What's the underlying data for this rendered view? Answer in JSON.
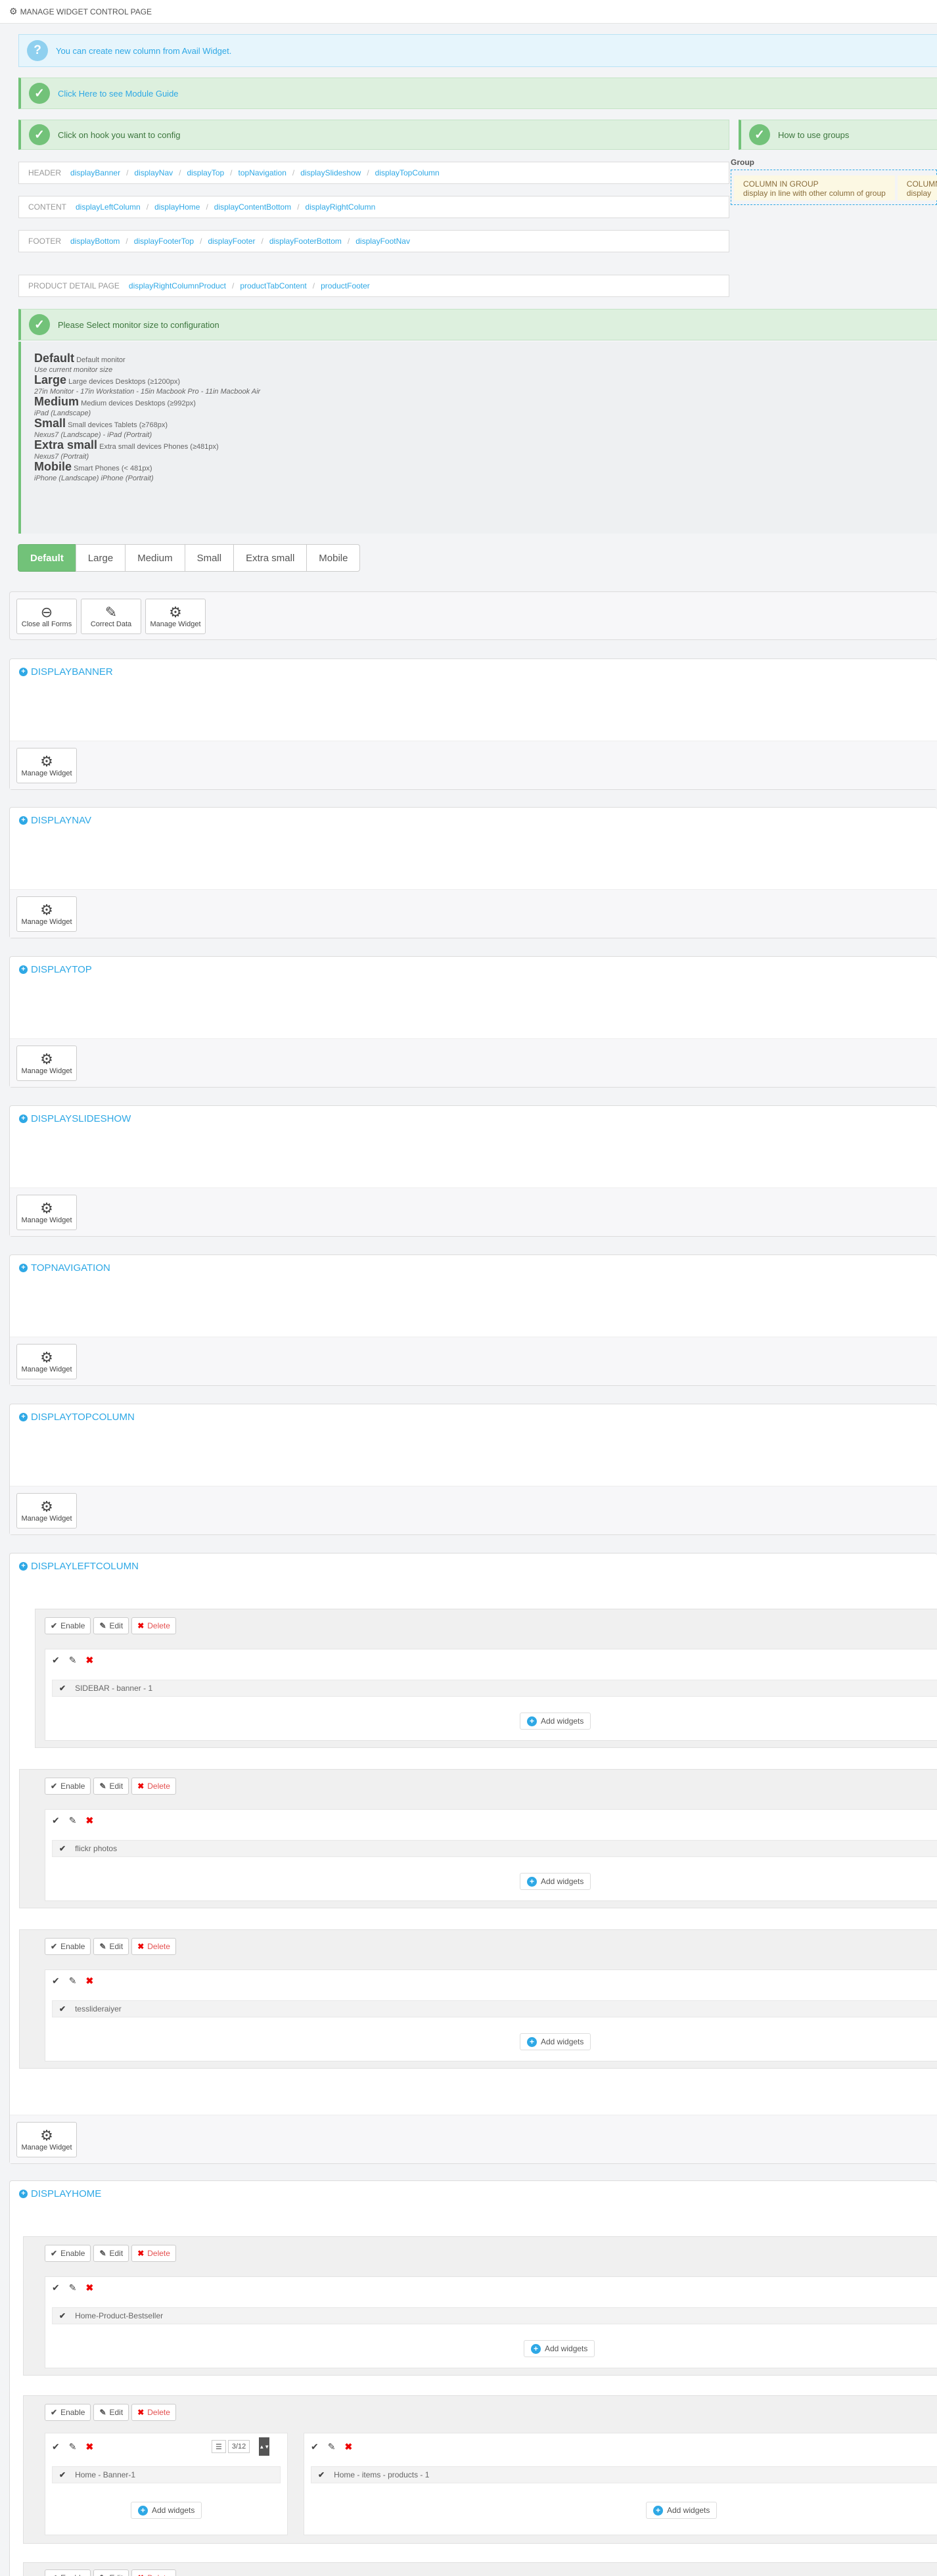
{
  "page": {
    "title": "MANAGE WIDGET CONTROL PAGE",
    "title_icon": "gear-icon"
  },
  "alerts": {
    "info_text": "You can create new column from Avail Widget.",
    "guide_text": "Click Here to see Module Guide",
    "hook_text": "Click on hook you want to config",
    "groups_text": "How to use groups",
    "monitor_text": "Please Select monitor size to configuration"
  },
  "hooks": {
    "header": {
      "label": "HEADER",
      "items": [
        "displayBanner",
        "displayNav",
        "displayTop",
        "topNavigation",
        "displaySlideshow",
        "displayTopColumn"
      ]
    },
    "content": {
      "label": "CONTENT",
      "items": [
        "displayLeftColumn",
        "displayHome",
        "displayContentBottom",
        "displayRightColumn"
      ]
    },
    "footer": {
      "label": "FOOTER",
      "items": [
        "displayBottom",
        "displayFooterTop",
        "displayFooter",
        "displayFooterBottom",
        "displayFootNav"
      ]
    },
    "product": {
      "label": "PRODUCT DETAIL PAGE",
      "items": [
        "displayRightColumnProduct",
        "productTabContent",
        "productFooter"
      ]
    }
  },
  "group": {
    "label": "Group",
    "cell1_title": "COLUMN IN GROUP",
    "cell1_desc": "display in line with other column of group",
    "cell2_title": "COLUMN",
    "cell2_desc": "display"
  },
  "monitor": {
    "default_title": "Default",
    "default_sub": "Default monitor",
    "default_note": "Use current monitor size",
    "large_title": "Large",
    "large_sub": "Large devices Desktops (≥1200px)",
    "large_note": "27in Monitor - 17in Workstation - 15in Macbook Pro - 11in Macbook Air",
    "medium_title": "Medium",
    "medium_sub": "Medium devices Desktops (≥992px)",
    "medium_note": "iPad (Landscape)",
    "small_title": "Small",
    "small_sub": "Small devices Tablets (≥768px)",
    "small_note": "Nexus7 (Landscape) - iPad (Portrait)",
    "xs_title": "Extra small",
    "xs_sub": "Extra small devices Phones (≥481px)",
    "xs_note": "Nexus7 (Portrait)",
    "mobile_title": "Mobile",
    "mobile_sub": "Smart Phones (< 481px)",
    "mobile_note": "iPhone (Landscape) iPhone (Portrait)"
  },
  "sizes": [
    "Default",
    "Large",
    "Medium",
    "Small",
    "Extra small",
    "Mobile"
  ],
  "actions": {
    "close_all": "Close all Forms",
    "correct": "Correct Data",
    "manage": "Manage Widget"
  },
  "sections": {
    "banner": "DISPLAYBANNER",
    "nav": "DISPLAYNAV",
    "top": "DISPLAYTOP",
    "slideshow": "DISPLAYSLIDESHOW",
    "topnav": "TOPNAVIGATION",
    "topcolumn": "DISPLAYTOPCOLUMN",
    "leftcolumn": "DISPLAYLEFTCOLUMN",
    "home": "DISPLAYHOME"
  },
  "row_buttons": {
    "enable": "Enable",
    "edit": "Edit",
    "delete": "Delete"
  },
  "add_widgets": "Add widgets",
  "widgets": {
    "left1": "SIDEBAR - banner - 1",
    "left2": "flickr photos",
    "left3": "tesslideraiyer",
    "home1": "Home-Product-Bestseller",
    "home2a": "Home - Banner-1",
    "home2b": "Home - items - products - 1"
  },
  "width_select": {
    "value": "3/12"
  }
}
